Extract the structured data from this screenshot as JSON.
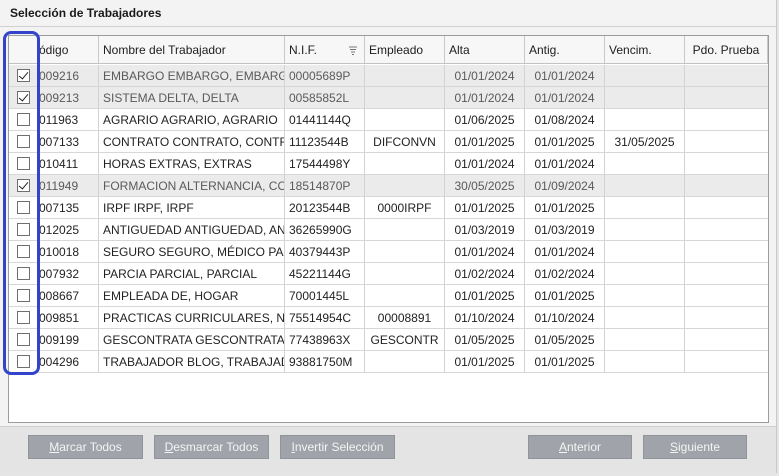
{
  "panel": {
    "title": "Selección de Trabajadores"
  },
  "table": {
    "columns": [
      "ódigo",
      "Nombre del Trabajador",
      "N.I.F.",
      "Empleado",
      "Alta",
      "Antig.",
      "Vencim.",
      "Pdo. Prueba"
    ],
    "sort_icon": "sort-descending-icon",
    "rows": [
      {
        "checked": true,
        "codigo": "009216",
        "nombre": "EMBARGO EMBARGO, EMBARGO",
        "nif": "00005689P",
        "empleado": "",
        "alta": "01/01/2024",
        "antig": "01/01/2024",
        "vencim": "",
        "prueba": ""
      },
      {
        "checked": true,
        "codigo": "009213",
        "nombre": "SISTEMA DELTA, DELTA",
        "nif": "00585852L",
        "empleado": "",
        "alta": "01/01/2024",
        "antig": "01/01/2024",
        "vencim": "",
        "prueba": ""
      },
      {
        "checked": false,
        "codigo": "011963",
        "nombre": "AGRARIO AGRARIO, AGRARIO",
        "nif": "01441144Q",
        "empleado": "",
        "alta": "01/06/2025",
        "antig": "01/08/2024",
        "vencim": "",
        "prueba": ""
      },
      {
        "checked": false,
        "codigo": "007133",
        "nombre": "CONTRATO CONTRATO, CONTRAT",
        "nif": "11123544B",
        "empleado": "DIFCONVN",
        "alta": "01/01/2025",
        "antig": "01/01/2025",
        "vencim": "31/05/2025",
        "prueba": ""
      },
      {
        "checked": false,
        "codigo": "010411",
        "nombre": "HORAS EXTRAS, EXTRAS",
        "nif": "17544498Y",
        "empleado": "",
        "alta": "01/01/2024",
        "antig": "01/01/2024",
        "vencim": "",
        "prueba": ""
      },
      {
        "checked": true,
        "codigo": "011949",
        "nombre": "FORMACION ALTERNANCIA, CONT",
        "nif": "18514870P",
        "empleado": "",
        "alta": "30/05/2025",
        "antig": "01/09/2024",
        "vencim": "",
        "prueba": ""
      },
      {
        "checked": false,
        "codigo": "007135",
        "nombre": "IRPF IRPF, IRPF",
        "nif": "20123544B",
        "empleado": "0000IRPF",
        "alta": "01/01/2025",
        "antig": "01/01/2025",
        "vencim": "",
        "prueba": ""
      },
      {
        "checked": false,
        "codigo": "012025",
        "nombre": "ANTIGUEDAD ANTIGUEDAD, ANTIC",
        "nif": "36265990G",
        "empleado": "",
        "alta": "01/03/2019",
        "antig": "01/03/2019",
        "vencim": "",
        "prueba": ""
      },
      {
        "checked": false,
        "codigo": "010018",
        "nombre": "SEGURO SEGURO, MÉDICO PARCI",
        "nif": "40379443P",
        "empleado": "",
        "alta": "01/01/2024",
        "antig": "01/01/2024",
        "vencim": "",
        "prueba": ""
      },
      {
        "checked": false,
        "codigo": "007932",
        "nombre": "PARCIA PARCIAL, PARCIAL",
        "nif": "45221144G",
        "empleado": "",
        "alta": "01/02/2024",
        "antig": "01/02/2024",
        "vencim": "",
        "prueba": ""
      },
      {
        "checked": false,
        "codigo": "008667",
        "nombre": "EMPLEADA DE, HOGAR",
        "nif": "70001445L",
        "empleado": "",
        "alta": "01/01/2025",
        "antig": "01/01/2025",
        "vencim": "",
        "prueba": ""
      },
      {
        "checked": false,
        "codigo": "009851",
        "nombre": "PRACTICAS CURRICULARES, NO RE",
        "nif": "75514954C",
        "empleado": "00008891",
        "alta": "01/10/2024",
        "antig": "01/10/2024",
        "vencim": "",
        "prueba": ""
      },
      {
        "checked": false,
        "codigo": "009199",
        "nombre": "GESCONTRATA GESCONTRATA, G",
        "nif": "77438963X",
        "empleado": "GESCONTR",
        "alta": "01/05/2025",
        "antig": "01/05/2025",
        "vencim": "",
        "prueba": ""
      },
      {
        "checked": false,
        "codigo": "004296",
        "nombre": "TRABAJADOR BLOG, TRABAJADO",
        "nif": "93881750M",
        "empleado": "",
        "alta": "01/01/2025",
        "antig": "01/01/2025",
        "vencim": "",
        "prueba": ""
      }
    ]
  },
  "buttons": {
    "marcar_todos": {
      "pre": "",
      "ul": "M",
      "post": "arcar Todos"
    },
    "desmarcar_todos": {
      "pre": "",
      "ul": "D",
      "post": "esmarcar Todos"
    },
    "invertir_seleccion": {
      "pre": "",
      "ul": "I",
      "post": "nvertir Selección"
    },
    "anterior": {
      "pre": "",
      "ul": "A",
      "post": "nterior"
    },
    "siguiente": {
      "pre": "",
      "ul": "S",
      "post": "iguiente"
    }
  },
  "colors": {
    "highlight": "#3344cc",
    "button_bg": "#a0a4aa",
    "checked_row_bg": "#ebebeb"
  }
}
